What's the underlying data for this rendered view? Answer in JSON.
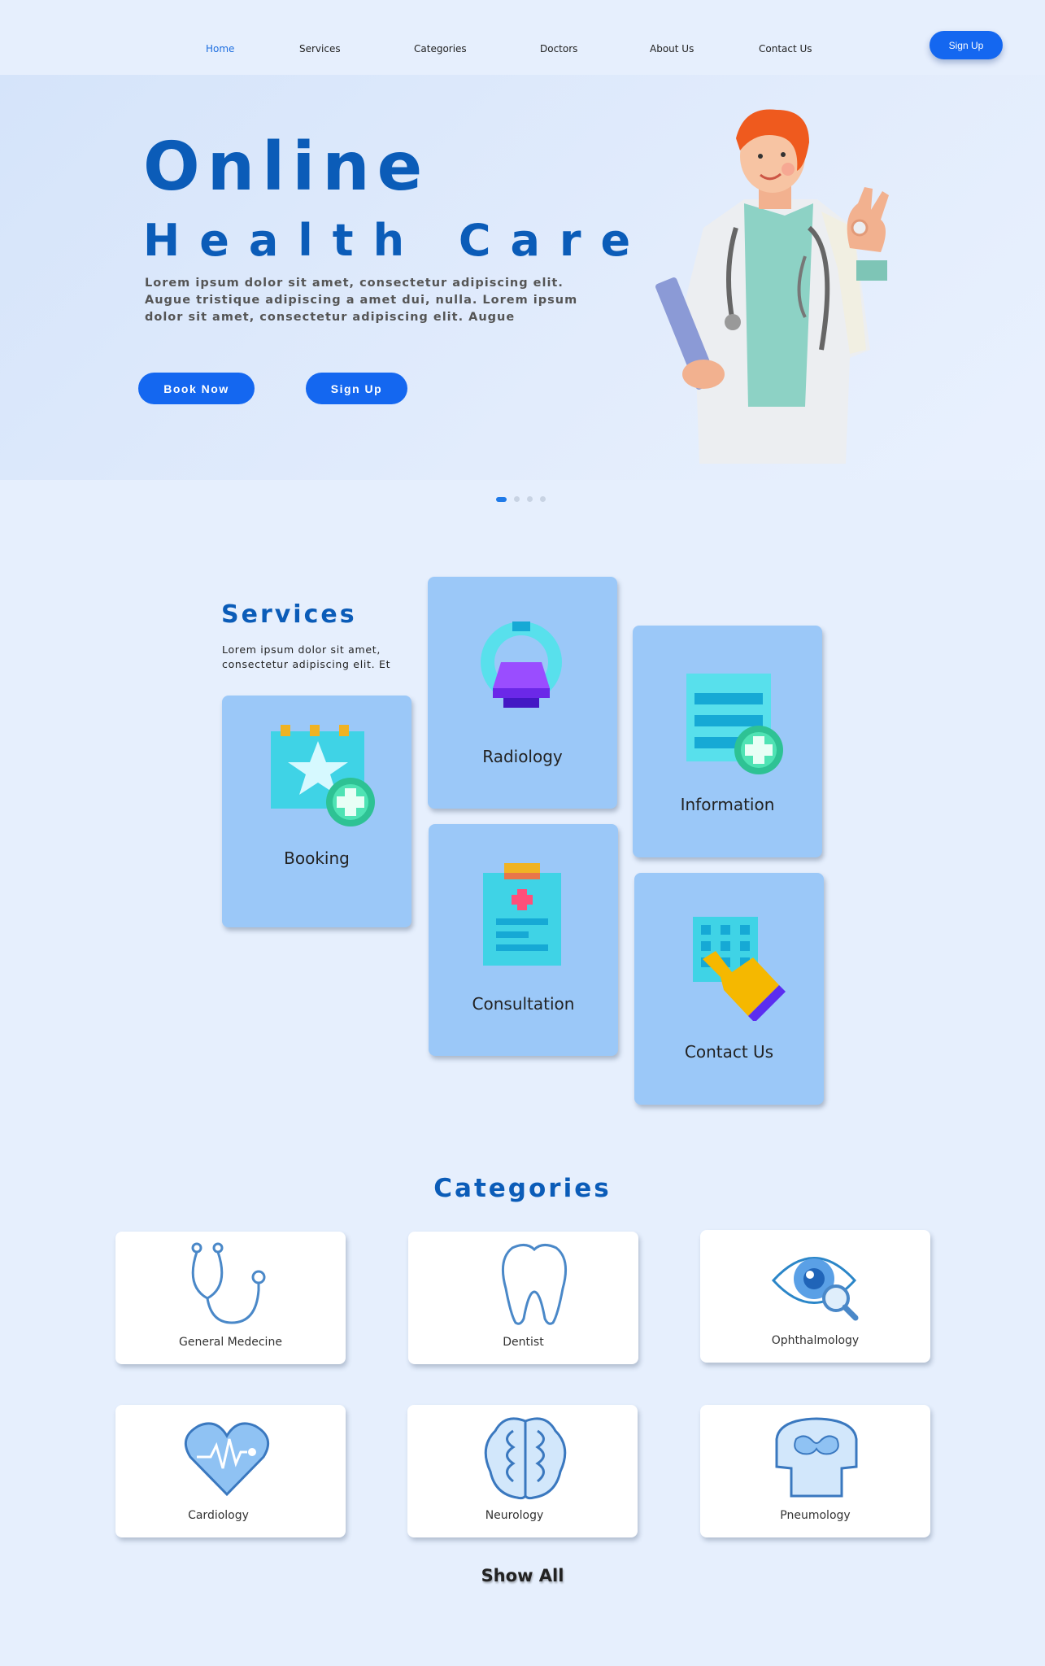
{
  "nav": {
    "items": [
      {
        "label": "Home",
        "active": true
      },
      {
        "label": "Services"
      },
      {
        "label": "Categories"
      },
      {
        "label": "Doctors"
      },
      {
        "label": "About Us"
      },
      {
        "label": "Contact Us"
      }
    ],
    "signup_label": "Sign Up"
  },
  "hero": {
    "title_line1": "Online",
    "title_line2": "Health Care",
    "description": "Lorem ipsum dolor sit amet, consectetur adipiscing elit. Augue tristique adipiscing a amet dui, nulla. Lorem ipsum dolor sit amet, consectetur adipiscing elit. Augue",
    "book_now_label": "Book Now",
    "signup_label": "Sign Up",
    "illustration": "doctor-illustration",
    "slides_total": 4,
    "slide_active": 1
  },
  "services": {
    "title": "Services",
    "description": "Lorem ipsum dolor sit amet, consectetur adipiscing elit. Et",
    "cards": [
      {
        "label": "Booking",
        "icon": "calendar-star-plus-icon"
      },
      {
        "label": "Radiology",
        "icon": "mri-scanner-icon"
      },
      {
        "label": "Information",
        "icon": "document-plus-icon"
      },
      {
        "label": "Consultation",
        "icon": "clipboard-medical-icon"
      },
      {
        "label": "Contact Us",
        "icon": "hand-keypad-icon"
      }
    ]
  },
  "categories": {
    "title": "Categories",
    "items": [
      {
        "label": "General Medecine",
        "icon": "stethoscope-icon"
      },
      {
        "label": "Dentist",
        "icon": "tooth-icon"
      },
      {
        "label": "Ophthalmology",
        "icon": "eye-magnifier-icon"
      },
      {
        "label": "Cardiology",
        "icon": "heart-pulse-icon"
      },
      {
        "label": "Neurology",
        "icon": "brain-icon"
      },
      {
        "label": "Pneumology",
        "icon": "lungs-torso-icon"
      }
    ],
    "show_all_label": "Show All"
  },
  "colors": {
    "background": "#e6effd",
    "primary": "#1467f0",
    "heading": "#0b5cb8",
    "card": "#9bc8f8"
  }
}
